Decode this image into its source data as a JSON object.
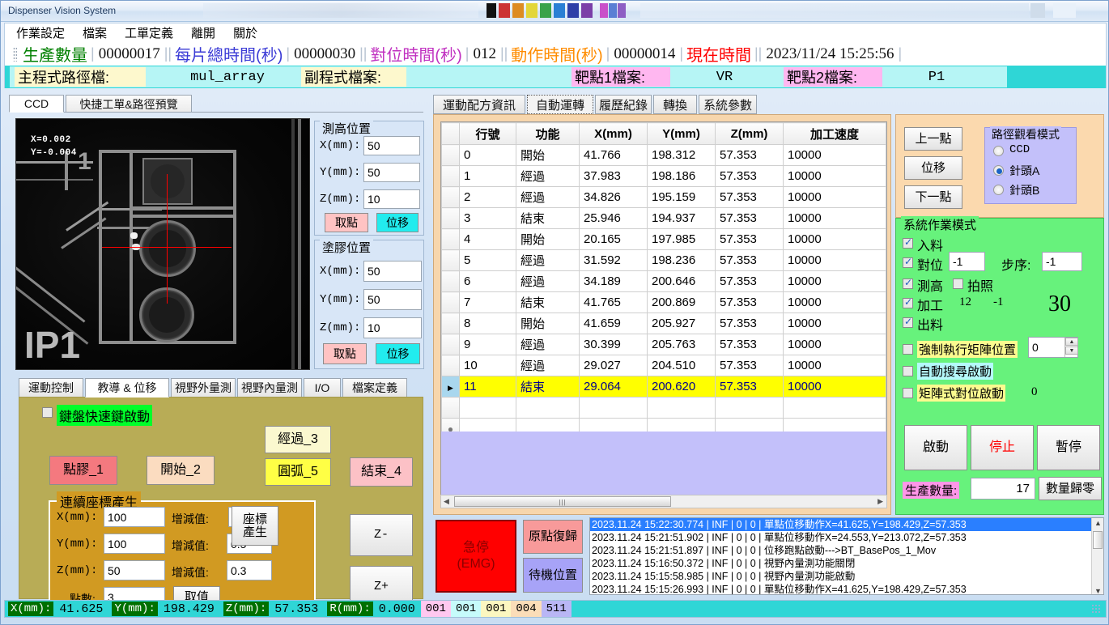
{
  "window": {
    "title": "Dispenser Vision System"
  },
  "menu": {
    "items": [
      "作業設定",
      "檔案",
      "工單定義",
      "離開",
      "關於"
    ]
  },
  "infobar": {
    "items": [
      {
        "label": "生產數量",
        "value": "00000017",
        "color": "#008000"
      },
      {
        "label": "每片總時間(秒)",
        "value": "00000030",
        "color": "#3b3bd6"
      },
      {
        "label": "對位時間(秒)",
        "value": "012",
        "color": "#c030c0"
      },
      {
        "label": "動作時間(秒)",
        "value": "00000014",
        "color": "#ff8c00"
      },
      {
        "label": "現在時間",
        "value": "2023/11/24  15:25:56",
        "color": "#ff0000"
      }
    ]
  },
  "pathbar": {
    "main_label": "主程式路徑檔:",
    "main_value": "mul_array",
    "sub_label": "副程式檔案:",
    "sub_value": "",
    "target1_label": "靶點1檔案:",
    "target1_value": "VR",
    "target2_label": "靶點2檔案:",
    "target2_value": "P1"
  },
  "left_tabs": {
    "items": [
      "CCD",
      "快捷工單&路徑預覽"
    ],
    "active": 0
  },
  "ccd": {
    "overlay_x": "X=0.002",
    "overlay_y": "Y=-0.004",
    "silk_text": "IP1",
    "silk_num": "1"
  },
  "height_group": {
    "title": "測高位置",
    "x_label": "X(mm):",
    "x_value": "50",
    "y_label": "Y(mm):",
    "y_value": "50",
    "z_label": "Z(mm):",
    "z_value": "10",
    "pick_btn": "取點",
    "move_btn": "位移"
  },
  "glue_group": {
    "title": "塗膠位置",
    "x_label": "X(mm):",
    "x_value": "50",
    "y_label": "Y(mm):",
    "y_value": "50",
    "z_label": "Z(mm):",
    "z_value": "10",
    "pick_btn": "取點",
    "move_btn": "位移"
  },
  "bottom_tabs": {
    "items": [
      "運動控制",
      "教導 & 位移",
      "視野外量測",
      "視野內量測",
      "I/O",
      "檔案定義"
    ],
    "active": 1
  },
  "teach": {
    "hotkey_label": "鍵盤快速鍵啟動",
    "hotkey_checked": false,
    "btn_glue": "點膠_1",
    "btn_start": "開始_2",
    "btn_pass": "經過_3",
    "btn_arc": "圓弧_5",
    "btn_end": "結束_4",
    "btn_zminus": "Z-",
    "btn_zplus": "Z+",
    "coordgen": {
      "title": "連續座標產生",
      "x_label": "X(mm):",
      "x_value": "100",
      "x_step_label": "增減值:",
      "x_step": "0",
      "y_label": "Y(mm):",
      "y_value": "100",
      "y_step_label": "增減值:",
      "y_step": "0.5",
      "z_label": "Z(mm):",
      "z_value": "50",
      "z_step_label": "增減值:",
      "z_step": "0.3",
      "count_label": "點數:",
      "count_value": "3",
      "take_btn": "取值",
      "gen_btn_line1": "座標",
      "gen_btn_line2": "產生"
    }
  },
  "right_tabs": {
    "items": [
      "運動配方資訊",
      "自動運轉",
      "履歷紀錄",
      "轉換",
      "系統參數"
    ],
    "active": 1
  },
  "grid": {
    "columns": [
      "行號",
      "功能",
      "X(mm)",
      "Y(mm)",
      "Z(mm)",
      "加工速度"
    ],
    "rows": [
      {
        "no": "0",
        "fn": "開始",
        "x": "41.766",
        "y": "198.312",
        "z": "57.353",
        "spd": "10000",
        "selected": false
      },
      {
        "no": "1",
        "fn": "經過",
        "x": "37.983",
        "y": "198.186",
        "z": "57.353",
        "spd": "10000",
        "selected": false
      },
      {
        "no": "2",
        "fn": "經過",
        "x": "34.826",
        "y": "195.159",
        "z": "57.353",
        "spd": "10000",
        "selected": false
      },
      {
        "no": "3",
        "fn": "結束",
        "x": "25.946",
        "y": "194.937",
        "z": "57.353",
        "spd": "10000",
        "selected": false
      },
      {
        "no": "4",
        "fn": "開始",
        "x": "20.165",
        "y": "197.985",
        "z": "57.353",
        "spd": "10000",
        "selected": false
      },
      {
        "no": "5",
        "fn": "經過",
        "x": "31.592",
        "y": "198.236",
        "z": "57.353",
        "spd": "10000",
        "selected": false
      },
      {
        "no": "6",
        "fn": "經過",
        "x": "34.189",
        "y": "200.646",
        "z": "57.353",
        "spd": "10000",
        "selected": false
      },
      {
        "no": "7",
        "fn": "結束",
        "x": "41.765",
        "y": "200.869",
        "z": "57.353",
        "spd": "10000",
        "selected": false
      },
      {
        "no": "8",
        "fn": "開始",
        "x": "41.659",
        "y": "205.927",
        "z": "57.353",
        "spd": "10000",
        "selected": false
      },
      {
        "no": "9",
        "fn": "經過",
        "x": "30.399",
        "y": "205.763",
        "z": "57.353",
        "spd": "10000",
        "selected": false
      },
      {
        "no": "10",
        "fn": "經過",
        "x": "29.027",
        "y": "204.510",
        "z": "57.353",
        "spd": "10000",
        "selected": false
      },
      {
        "no": "11",
        "fn": "結束",
        "x": "29.064",
        "y": "200.620",
        "z": "57.353",
        "spd": "10000",
        "selected": true
      },
      {
        "no": "",
        "fn": "",
        "x": "",
        "y": "",
        "z": "",
        "spd": "",
        "selected": false
      },
      {
        "no": "",
        "fn": "",
        "x": "",
        "y": "",
        "z": "",
        "spd": "",
        "selected": false
      }
    ]
  },
  "nav": {
    "prev_point": "上一點",
    "move": "位移",
    "next_point": "下一點"
  },
  "view_mode": {
    "title": "路徑觀看模式",
    "options": [
      "CCD",
      "針頭A",
      "針頭B"
    ],
    "selected": 1
  },
  "sysmode": {
    "title": "系統作業模式",
    "feed_label": "入料",
    "feed_checked": true,
    "align_label": "對位",
    "align_checked": true,
    "align_value": "-1",
    "step_label": "步序:",
    "step_value": "-1",
    "height_label": "測高",
    "height_checked": true,
    "photo_label": "拍照",
    "photo_checked": false,
    "process_label": "加工",
    "process_checked": true,
    "process_v1": "12",
    "process_v2": "-1",
    "out_label": "出料",
    "out_checked": true,
    "big_number": "30",
    "force_matrix_label": "強制執行矩陣位置",
    "force_matrix_checked": false,
    "force_matrix_value": "0",
    "autosearch_label": "自動搜尋啟動",
    "autosearch_checked": false,
    "matrix_align_label": "矩陣式對位啟動",
    "matrix_align_checked": false,
    "matrix_align_value": "0",
    "start_btn": "啟動",
    "stop_btn": "停止",
    "pause_btn": "暫停",
    "count_label": "生產數量:",
    "count_value": "17",
    "reset_btn": "數量歸零"
  },
  "emergency": {
    "line1": "急停",
    "line2": "(EMG)"
  },
  "side_buttons": {
    "home": "原點復歸",
    "standby": "待機位置"
  },
  "log": {
    "entries": [
      {
        "text": "2023.11.24 15:22:30.774 | INF | 0 | 0 | 單點位移動作X=41.625,Y=198.429,Z=57.353",
        "selected": true
      },
      {
        "text": "2023.11.24 15:21:51.902 | INF | 0 | 0 | 單點位移動作X=24.553,Y=213.072,Z=57.353",
        "selected": false
      },
      {
        "text": "2023.11.24 15:21:51.897 | INF | 0 | 0 | 位移跑點啟動--->BT_BasePos_1_Mov",
        "selected": false
      },
      {
        "text": "2023.11.24 15:16:50.372 | INF | 0 | 0 | 視野內量測功能關閉",
        "selected": false
      },
      {
        "text": "2023.11.24 15:15:58.985 | INF | 0 | 0 | 視野內量測功能啟動",
        "selected": false
      },
      {
        "text": "2023.11.24 15:15:26.993 | INF | 0 | 0 | 單點位移動作X=41.625,Y=198.429,Z=57.353",
        "selected": false
      }
    ]
  },
  "statusbar": {
    "x_label": "X(mm):",
    "x_value": "41.625",
    "y_label": "Y(mm):",
    "y_value": "198.429",
    "z_label": "Z(mm):",
    "z_value": "57.353",
    "r_label": "R(mm):",
    "r_value": "0.000",
    "badges": [
      {
        "text": "001",
        "color": "#ffc8f0"
      },
      {
        "text": "001",
        "color": "#c6fbfb"
      },
      {
        "text": "001",
        "color": "#fcf7c0"
      },
      {
        "text": "004",
        "color": "#fbddb8"
      },
      {
        "text": "511",
        "color": "#b9b6f5"
      }
    ]
  }
}
